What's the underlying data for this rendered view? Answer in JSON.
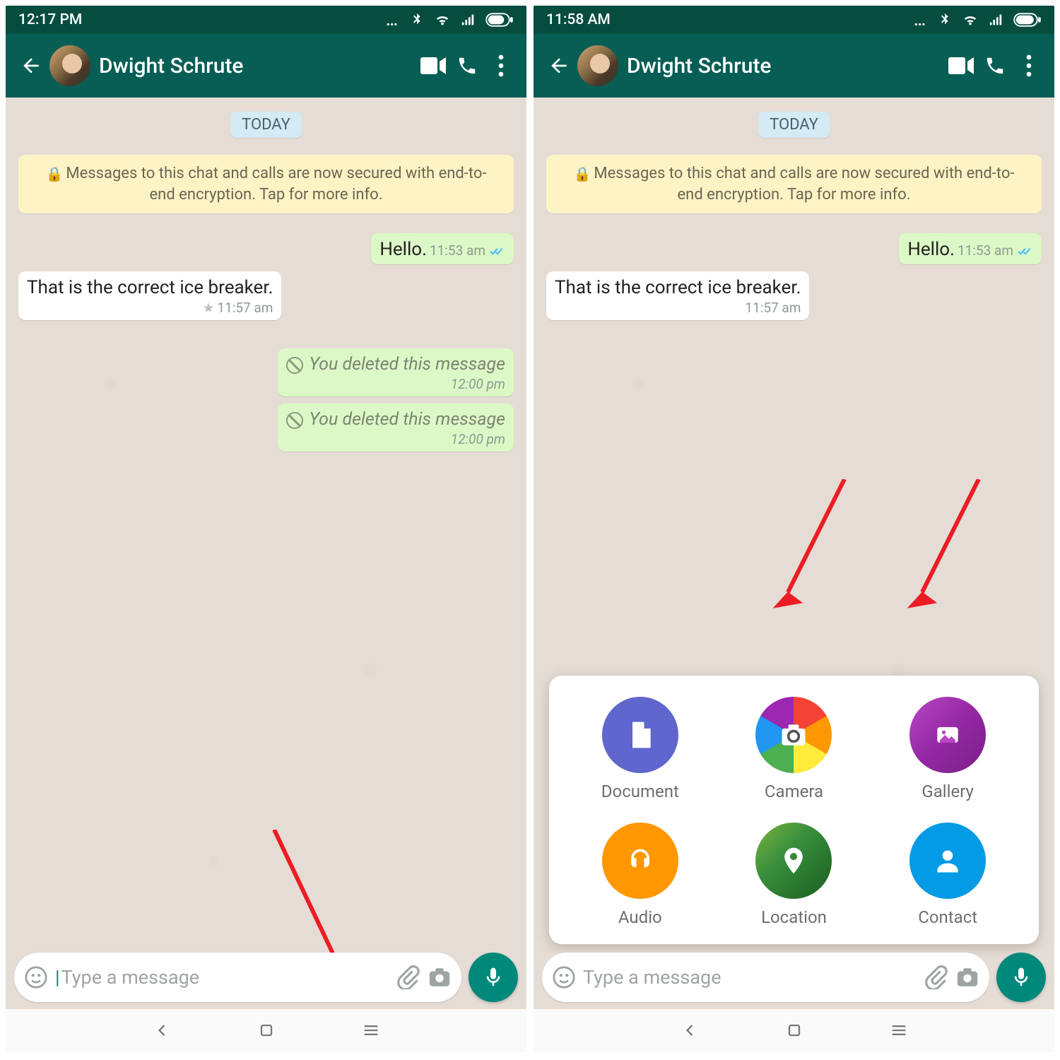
{
  "left": {
    "status_time": "12:17 PM",
    "contact": "Dwight Schrute",
    "date_chip": "TODAY",
    "encryption_text": "Messages to this chat and calls are now secured with end-to-end encryption. Tap for more info.",
    "msg_out_1": "Hello.",
    "msg_out_1_time": "11:53 am",
    "msg_in_1": "That is the correct ice breaker.",
    "msg_in_1_time": "11:57 am",
    "deleted_text": "You deleted this message",
    "deleted_1_time": "12:00 pm",
    "deleted_2_time": "12:00 pm",
    "input_placeholder": "Type a message"
  },
  "right": {
    "status_time": "11:58 AM",
    "contact": "Dwight Schrute",
    "date_chip": "TODAY",
    "encryption_text": "Messages to this chat and calls are now secured with end-to-end encryption. Tap for more info.",
    "msg_out_1": "Hello.",
    "msg_out_1_time": "11:53 am",
    "msg_in_1": "That is the correct ice breaker.",
    "msg_in_1_time": "11:57 am",
    "input_placeholder": "Type a message",
    "attach": {
      "document": "Document",
      "camera": "Camera",
      "gallery": "Gallery",
      "audio": "Audio",
      "location": "Location",
      "contact": "Contact"
    }
  }
}
